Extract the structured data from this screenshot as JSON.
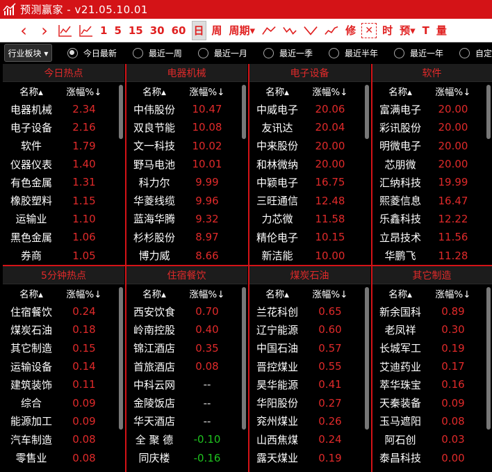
{
  "app": {
    "title": "预测赢家 - v21.05.10.01"
  },
  "toolbar": [
    {
      "name": "back-icon",
      "glyph": "‹",
      "int": true
    },
    {
      "name": "forward-icon",
      "glyph": "›",
      "int": true
    },
    {
      "name": "kline-chart-icon",
      "glyph": "svg1",
      "int": true
    },
    {
      "name": "trend-chart-icon",
      "glyph": "svg2",
      "int": true
    },
    {
      "name": "period-1-button",
      "label": "1",
      "int": true
    },
    {
      "name": "period-5-button",
      "label": "5",
      "int": true
    },
    {
      "name": "period-15-button",
      "label": "15",
      "int": true
    },
    {
      "name": "period-30-button",
      "label": "30",
      "int": true
    },
    {
      "name": "period-60-button",
      "label": "60",
      "int": true
    },
    {
      "name": "period-day-button",
      "label": "日",
      "int": true,
      "selected": true
    },
    {
      "name": "period-week-button",
      "label": "周",
      "int": true
    },
    {
      "name": "period-menu-button",
      "label": "周期▾",
      "int": true
    },
    {
      "name": "pattern-1-icon",
      "glyph": "svg3",
      "int": true
    },
    {
      "name": "pattern-2-icon",
      "glyph": "svg4",
      "int": true
    },
    {
      "name": "pattern-3-icon",
      "glyph": "svg5",
      "int": true
    },
    {
      "name": "pattern-4-icon",
      "glyph": "svg6",
      "int": true
    },
    {
      "name": "edit-button",
      "label": "修",
      "int": true
    },
    {
      "name": "crosshair-icon",
      "glyph": "✕",
      "int": true,
      "box": true
    },
    {
      "name": "time-button",
      "label": "时",
      "int": true
    },
    {
      "name": "predict-menu-button",
      "label": "预▾",
      "int": true
    },
    {
      "name": "text-tool-button",
      "label": "T",
      "int": true
    },
    {
      "name": "quantity-button",
      "label": "量",
      "int": true
    }
  ],
  "filters": {
    "sector_select": "行业板块 ▾",
    "options": [
      {
        "label": "今日最新",
        "checked": true
      },
      {
        "label": "最近一周",
        "checked": false
      },
      {
        "label": "最近一月",
        "checked": false
      },
      {
        "label": "最近一季",
        "checked": false
      },
      {
        "label": "最近半年",
        "checked": false
      },
      {
        "label": "最近一年",
        "checked": false
      },
      {
        "label": "自定",
        "checked": false
      }
    ]
  },
  "colors": {
    "accent": "#d41317",
    "up": "#e02a2a",
    "down": "#1fc21f"
  },
  "panels": [
    {
      "title": "今日热点",
      "col1": "名称▴",
      "col2": "涨幅%↓",
      "rows": [
        [
          "电器机械",
          "2.34"
        ],
        [
          "电子设备",
          "2.16"
        ],
        [
          "软件",
          "1.79"
        ],
        [
          "仪器仪表",
          "1.40"
        ],
        [
          "有色金属",
          "1.31"
        ],
        [
          "橡胶塑料",
          "1.15"
        ],
        [
          "运输业",
          "1.10"
        ],
        [
          "黑色金属",
          "1.06"
        ],
        [
          "券商",
          "1.05"
        ]
      ]
    },
    {
      "title": "电器机械",
      "col1": "名称▴",
      "col2": "涨幅%↓",
      "rows": [
        [
          "中伟股份",
          "10.47"
        ],
        [
          "双良节能",
          "10.08"
        ],
        [
          "文一科技",
          "10.02"
        ],
        [
          "野马电池",
          "10.01"
        ],
        [
          "科力尔",
          "9.99"
        ],
        [
          "华菱线缆",
          "9.96"
        ],
        [
          "蓝海华腾",
          "9.32"
        ],
        [
          "杉杉股份",
          "8.97"
        ],
        [
          "博力威",
          "8.66"
        ]
      ]
    },
    {
      "title": "电子设备",
      "col1": "名称▴",
      "col2": "涨幅%↓",
      "rows": [
        [
          "中威电子",
          "20.06"
        ],
        [
          "友讯达",
          "20.04"
        ],
        [
          "中来股份",
          "20.00"
        ],
        [
          "和林微纳",
          "20.00"
        ],
        [
          "中颖电子",
          "16.75"
        ],
        [
          "三旺通信",
          "12.48"
        ],
        [
          "力芯微",
          "11.58"
        ],
        [
          "精伦电子",
          "10.15"
        ],
        [
          "新洁能",
          "10.00"
        ]
      ]
    },
    {
      "title": "软件",
      "col1": "名称▴",
      "col2": "涨幅%↓",
      "rows": [
        [
          "富满电子",
          "20.00"
        ],
        [
          "彩讯股份",
          "20.00"
        ],
        [
          "明微电子",
          "20.00"
        ],
        [
          "芯朋微",
          "20.00"
        ],
        [
          "汇纳科技",
          "19.99"
        ],
        [
          "熙菱信息",
          "16.47"
        ],
        [
          "乐鑫科技",
          "12.22"
        ],
        [
          "立昂技术",
          "11.56"
        ],
        [
          "华鹏飞",
          "11.28"
        ]
      ]
    },
    {
      "title": "5分钟热点",
      "col1": "名称▴",
      "col2": "涨幅%↓",
      "rows": [
        [
          "住宿餐饮",
          "0.24"
        ],
        [
          "煤炭石油",
          "0.18"
        ],
        [
          "其它制造",
          "0.15"
        ],
        [
          "运输设备",
          "0.14"
        ],
        [
          "建筑装饰",
          "0.11"
        ],
        [
          "综合",
          "0.09"
        ],
        [
          "能源加工",
          "0.09"
        ],
        [
          "汽车制造",
          "0.08"
        ],
        [
          "零售业",
          "0.08"
        ]
      ]
    },
    {
      "title": "住宿餐饮",
      "col1": "名称▴",
      "col2": "涨幅%↓",
      "rows": [
        [
          "西安饮食",
          "0.70"
        ],
        [
          "岭南控股",
          "0.40"
        ],
        [
          "锦江酒店",
          "0.35"
        ],
        [
          "首旅酒店",
          "0.08"
        ],
        [
          "中科云网",
          "--"
        ],
        [
          "金陵饭店",
          "--"
        ],
        [
          "华天酒店",
          "--"
        ],
        [
          "全 聚 德",
          "-0.10"
        ],
        [
          "同庆楼",
          "-0.16"
        ]
      ]
    },
    {
      "title": "煤炭石油",
      "col1": "名称▴",
      "col2": "涨幅%↓",
      "rows": [
        [
          "兰花科创",
          "0.65"
        ],
        [
          "辽宁能源",
          "0.60"
        ],
        [
          "中国石油",
          "0.57"
        ],
        [
          "晋控煤业",
          "0.55"
        ],
        [
          "昊华能源",
          "0.41"
        ],
        [
          "华阳股份",
          "0.27"
        ],
        [
          "兖州煤业",
          "0.26"
        ],
        [
          "山西焦煤",
          "0.24"
        ],
        [
          "露天煤业",
          "0.19"
        ]
      ]
    },
    {
      "title": "其它制造",
      "col1": "名称▴",
      "col2": "涨幅%↓",
      "rows": [
        [
          "新余国科",
          "0.89"
        ],
        [
          "老凤祥",
          "0.30"
        ],
        [
          "长城军工",
          "0.19"
        ],
        [
          "艾迪药业",
          "0.17"
        ],
        [
          "萃华珠宝",
          "0.16"
        ],
        [
          "天秦装备",
          "0.09"
        ],
        [
          "玉马遮阳",
          "0.08"
        ],
        [
          "阿石创",
          "0.03"
        ],
        [
          "泰昌科技",
          "0.00"
        ]
      ]
    }
  ]
}
